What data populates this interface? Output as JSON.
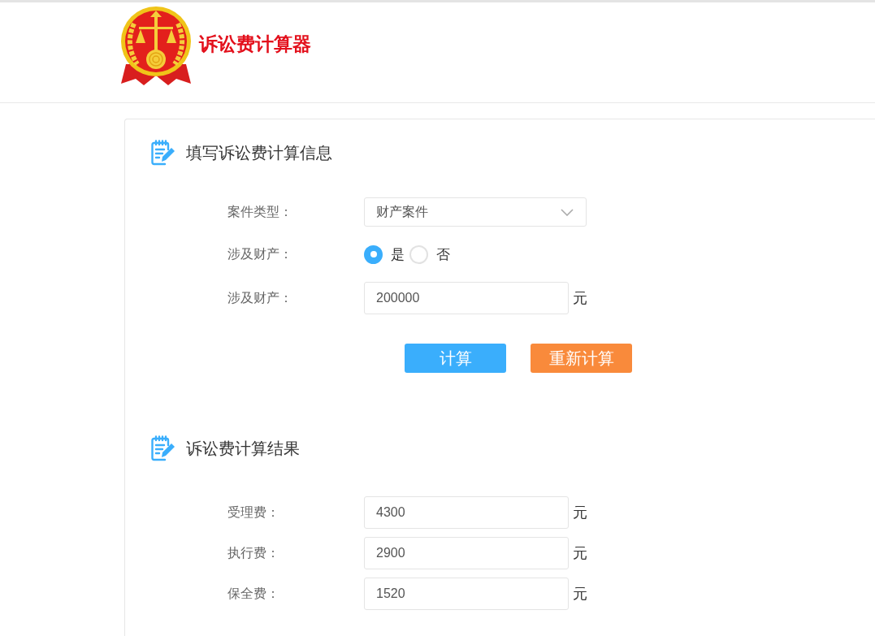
{
  "header": {
    "logo_text": "诉讼费计算器"
  },
  "sections": [
    {
      "title": "填写诉讼费计算信息",
      "fields": [
        {
          "kind": "select",
          "label": "案件类型：",
          "value": "财产案件"
        },
        {
          "kind": "radio",
          "label": "涉及财产：",
          "options": [
            {
              "label": "是",
              "selected": true
            },
            {
              "label": "否",
              "selected": false
            }
          ]
        },
        {
          "kind": "input",
          "label": "涉及财产：",
          "value": "200000",
          "unit": "元"
        }
      ],
      "buttons": [
        {
          "label": "计算",
          "kind": "primary"
        },
        {
          "label": "重新计算",
          "kind": "reset"
        }
      ]
    },
    {
      "title": "诉讼费计算结果",
      "fields": [
        {
          "kind": "input",
          "label": "受理费：",
          "value": "4300",
          "unit": "元"
        },
        {
          "kind": "input",
          "label": "执行费：",
          "value": "2900",
          "unit": "元"
        },
        {
          "kind": "input",
          "label": "保全费：",
          "value": "1520",
          "unit": "元"
        }
      ]
    }
  ]
}
